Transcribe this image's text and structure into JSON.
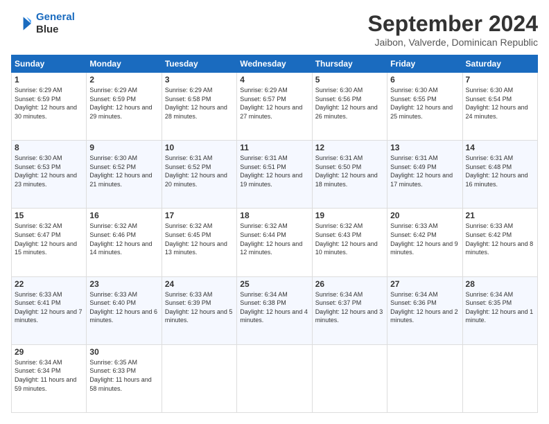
{
  "logo": {
    "line1": "General",
    "line2": "Blue"
  },
  "title": "September 2024",
  "subtitle": "Jaibon, Valverde, Dominican Republic",
  "weekdays": [
    "Sunday",
    "Monday",
    "Tuesday",
    "Wednesday",
    "Thursday",
    "Friday",
    "Saturday"
  ],
  "weeks": [
    [
      {
        "day": "1",
        "sunrise": "6:29 AM",
        "sunset": "6:59 PM",
        "daylight": "12 hours and 30 minutes."
      },
      {
        "day": "2",
        "sunrise": "6:29 AM",
        "sunset": "6:59 PM",
        "daylight": "12 hours and 29 minutes."
      },
      {
        "day": "3",
        "sunrise": "6:29 AM",
        "sunset": "6:58 PM",
        "daylight": "12 hours and 28 minutes."
      },
      {
        "day": "4",
        "sunrise": "6:29 AM",
        "sunset": "6:57 PM",
        "daylight": "12 hours and 27 minutes."
      },
      {
        "day": "5",
        "sunrise": "6:30 AM",
        "sunset": "6:56 PM",
        "daylight": "12 hours and 26 minutes."
      },
      {
        "day": "6",
        "sunrise": "6:30 AM",
        "sunset": "6:55 PM",
        "daylight": "12 hours and 25 minutes."
      },
      {
        "day": "7",
        "sunrise": "6:30 AM",
        "sunset": "6:54 PM",
        "daylight": "12 hours and 24 minutes."
      }
    ],
    [
      {
        "day": "8",
        "sunrise": "6:30 AM",
        "sunset": "6:53 PM",
        "daylight": "12 hours and 23 minutes."
      },
      {
        "day": "9",
        "sunrise": "6:30 AM",
        "sunset": "6:52 PM",
        "daylight": "12 hours and 21 minutes."
      },
      {
        "day": "10",
        "sunrise": "6:31 AM",
        "sunset": "6:52 PM",
        "daylight": "12 hours and 20 minutes."
      },
      {
        "day": "11",
        "sunrise": "6:31 AM",
        "sunset": "6:51 PM",
        "daylight": "12 hours and 19 minutes."
      },
      {
        "day": "12",
        "sunrise": "6:31 AM",
        "sunset": "6:50 PM",
        "daylight": "12 hours and 18 minutes."
      },
      {
        "day": "13",
        "sunrise": "6:31 AM",
        "sunset": "6:49 PM",
        "daylight": "12 hours and 17 minutes."
      },
      {
        "day": "14",
        "sunrise": "6:31 AM",
        "sunset": "6:48 PM",
        "daylight": "12 hours and 16 minutes."
      }
    ],
    [
      {
        "day": "15",
        "sunrise": "6:32 AM",
        "sunset": "6:47 PM",
        "daylight": "12 hours and 15 minutes."
      },
      {
        "day": "16",
        "sunrise": "6:32 AM",
        "sunset": "6:46 PM",
        "daylight": "12 hours and 14 minutes."
      },
      {
        "day": "17",
        "sunrise": "6:32 AM",
        "sunset": "6:45 PM",
        "daylight": "12 hours and 13 minutes."
      },
      {
        "day": "18",
        "sunrise": "6:32 AM",
        "sunset": "6:44 PM",
        "daylight": "12 hours and 12 minutes."
      },
      {
        "day": "19",
        "sunrise": "6:32 AM",
        "sunset": "6:43 PM",
        "daylight": "12 hours and 10 minutes."
      },
      {
        "day": "20",
        "sunrise": "6:33 AM",
        "sunset": "6:42 PM",
        "daylight": "12 hours and 9 minutes."
      },
      {
        "day": "21",
        "sunrise": "6:33 AM",
        "sunset": "6:42 PM",
        "daylight": "12 hours and 8 minutes."
      }
    ],
    [
      {
        "day": "22",
        "sunrise": "6:33 AM",
        "sunset": "6:41 PM",
        "daylight": "12 hours and 7 minutes."
      },
      {
        "day": "23",
        "sunrise": "6:33 AM",
        "sunset": "6:40 PM",
        "daylight": "12 hours and 6 minutes."
      },
      {
        "day": "24",
        "sunrise": "6:33 AM",
        "sunset": "6:39 PM",
        "daylight": "12 hours and 5 minutes."
      },
      {
        "day": "25",
        "sunrise": "6:34 AM",
        "sunset": "6:38 PM",
        "daylight": "12 hours and 4 minutes."
      },
      {
        "day": "26",
        "sunrise": "6:34 AM",
        "sunset": "6:37 PM",
        "daylight": "12 hours and 3 minutes."
      },
      {
        "day": "27",
        "sunrise": "6:34 AM",
        "sunset": "6:36 PM",
        "daylight": "12 hours and 2 minutes."
      },
      {
        "day": "28",
        "sunrise": "6:34 AM",
        "sunset": "6:35 PM",
        "daylight": "12 hours and 1 minute."
      }
    ],
    [
      {
        "day": "29",
        "sunrise": "6:34 AM",
        "sunset": "6:34 PM",
        "daylight": "11 hours and 59 minutes."
      },
      {
        "day": "30",
        "sunrise": "6:35 AM",
        "sunset": "6:33 PM",
        "daylight": "11 hours and 58 minutes."
      },
      null,
      null,
      null,
      null,
      null
    ]
  ]
}
